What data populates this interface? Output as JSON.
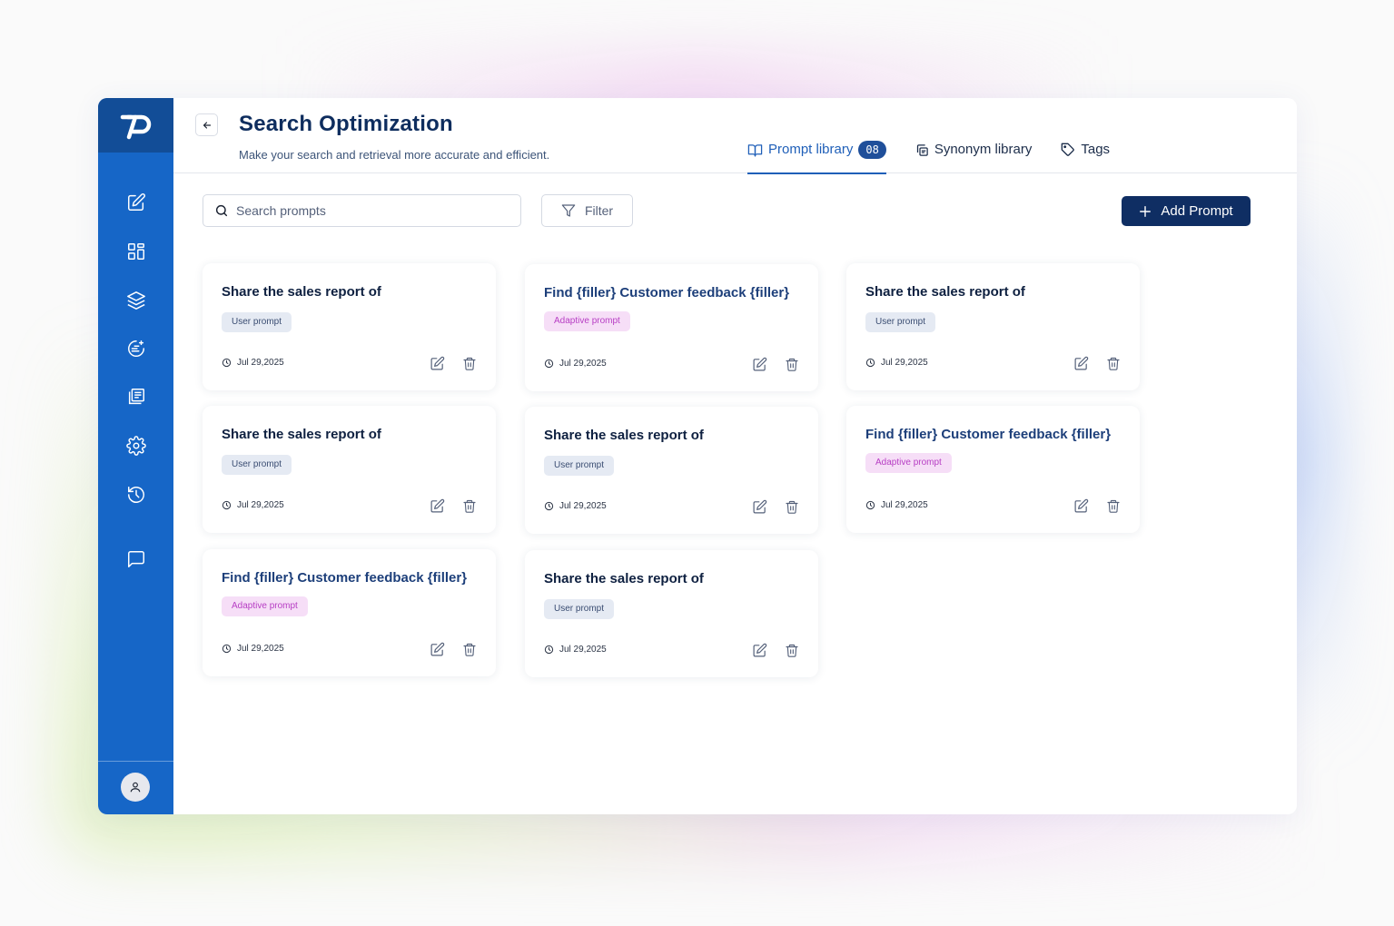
{
  "app": {
    "title": "Search Optimization",
    "subtitle": "Make your search and retrieval more accurate and efficient."
  },
  "sidebar": {
    "logo": "logo-icon",
    "items": [
      {
        "icon": "edit-icon"
      },
      {
        "icon": "dashboard-icon"
      },
      {
        "icon": "layers-icon"
      },
      {
        "icon": "sparkle-chat-icon"
      },
      {
        "icon": "library-icon"
      },
      {
        "icon": "gear-icon"
      },
      {
        "icon": "history-icon"
      },
      {
        "icon": "message-icon"
      }
    ],
    "avatar": "user-icon"
  },
  "tabs": [
    {
      "label": "Prompt library",
      "count": "08",
      "icon": "book-icon",
      "active": true
    },
    {
      "label": "Synonym library",
      "icon": "copy-icon"
    },
    {
      "label": "Tags",
      "icon": "tag-icon"
    }
  ],
  "toolbar": {
    "search_placeholder": "Search prompts",
    "filter_label": "Filter",
    "add_label": "Add Prompt"
  },
  "cards": [
    {
      "title": "Share the sales report of",
      "tag": "User prompt",
      "type": "user",
      "date": "Jul 29,2025"
    },
    {
      "title": "Find {filler} Customer feedback {filler}",
      "tag": "Adaptive prompt",
      "type": "adaptive",
      "date": "Jul 29,2025"
    },
    {
      "title": "Share the sales report of",
      "tag": "User prompt",
      "type": "user",
      "date": "Jul 29,2025"
    },
    {
      "title": "Share the sales report of",
      "tag": "User prompt",
      "type": "user",
      "date": "Jul 29,2025"
    },
    {
      "title": "Share the sales report of",
      "tag": "User prompt",
      "type": "user",
      "date": "Jul 29,2025"
    },
    {
      "title": "Find {filler} Customer feedback {filler}",
      "tag": "Adaptive prompt",
      "type": "adaptive",
      "date": "Jul 29,2025"
    },
    {
      "title": "Find {filler} Customer feedback {filler}",
      "tag": "Adaptive prompt",
      "type": "adaptive",
      "date": "Jul 29,2025"
    },
    {
      "title": "Share the sales report of",
      "tag": "User prompt",
      "type": "user",
      "date": "Jul 29,2025"
    }
  ],
  "colors": {
    "sidebar": "#1666c7",
    "sidebar_logo_bg": "#124d97",
    "primary_button": "#0f2e63",
    "active_tab": "#1f5fb8",
    "adaptive_tag_bg": "#f6def7",
    "user_tag_bg": "#e5eaf3"
  }
}
